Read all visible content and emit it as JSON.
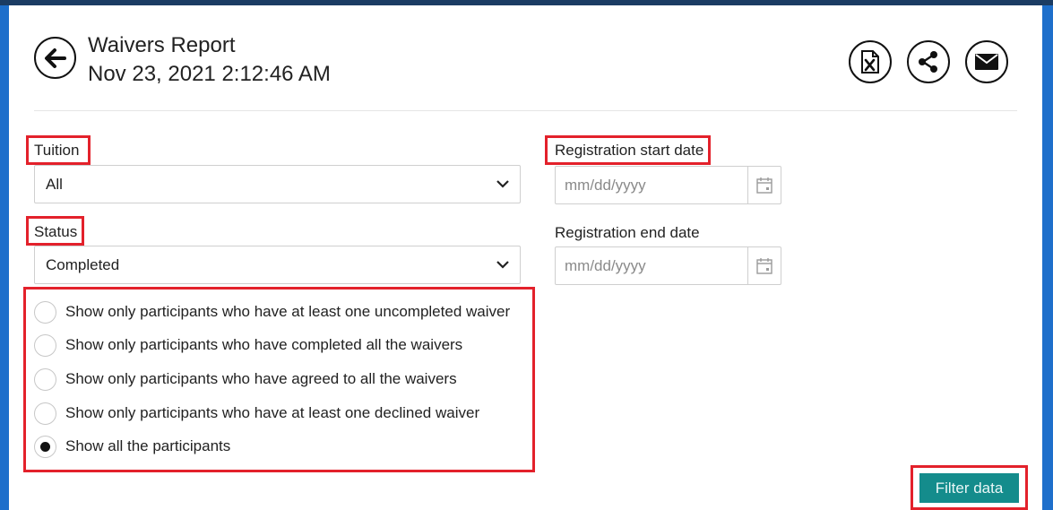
{
  "header": {
    "title": "Waivers Report",
    "timestamp": "Nov 23, 2021 2:12:46 AM"
  },
  "toolbar": {
    "export_icon": "excel-export-icon",
    "share_icon": "share-icon",
    "email_icon": "email-icon"
  },
  "tuition": {
    "label": "Tuition",
    "value": "All"
  },
  "status": {
    "label": "Status",
    "value": "Completed"
  },
  "registration_start": {
    "label": "Registration start date",
    "placeholder": "mm/dd/yyyy"
  },
  "registration_end": {
    "label": "Registration end date",
    "placeholder": "mm/dd/yyyy"
  },
  "options": [
    {
      "label": "Show only participants who have at least one uncompleted waiver",
      "selected": false
    },
    {
      "label": "Show only participants who have completed all the waivers",
      "selected": false
    },
    {
      "label": "Show only participants who have agreed to all the waivers",
      "selected": false
    },
    {
      "label": "Show only participants who have at least one declined waiver",
      "selected": false
    },
    {
      "label": "Show all the participants",
      "selected": true
    }
  ],
  "filter_button": "Filter data",
  "colors": {
    "highlight": "#e3212b",
    "accent_teal": "#148c8c",
    "frame_blue": "#1e6fcb",
    "topbar": "#1b3c63"
  }
}
